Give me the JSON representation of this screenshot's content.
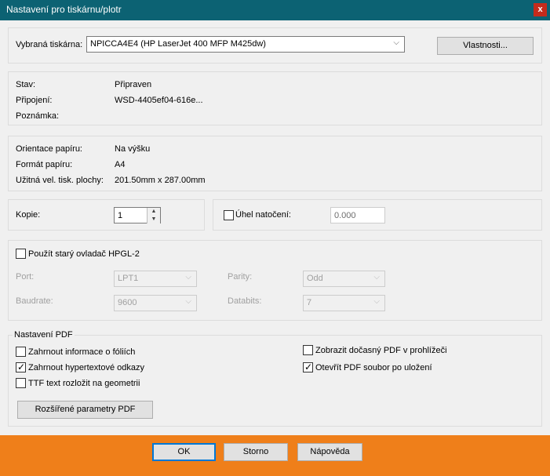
{
  "window": {
    "title": "Nastavení pro tiskárnu/plotr",
    "close_glyph": "x"
  },
  "printer": {
    "label": "Vybraná tiskárna:",
    "selected": "NPICCA4E4 (HP LaserJet 400 MFP M425dw)",
    "properties_button": "Vlastnosti..."
  },
  "status": {
    "state_label": "Stav:",
    "state_value": "Připraven",
    "connection_label": "Připojení:",
    "connection_value": "WSD-4405ef04-616e...",
    "note_label": "Poznámka:"
  },
  "paper": {
    "orientation_label": "Orientace papíru:",
    "orientation_value": "Na výšku",
    "format_label": "Formát papíru:",
    "format_value": "A4",
    "printable_label": "Užitná vel. tisk. plochy:",
    "printable_value": "201.50mm x 287.00mm"
  },
  "copies": {
    "label": "Kopie:",
    "value": "1"
  },
  "rotation": {
    "label": "Úhel natočení:",
    "checked": false,
    "value": "0.000"
  },
  "hpgl": {
    "label": "Použít starý ovladač HPGL-2",
    "checked": false,
    "port_label": "Port:",
    "port_value": "LPT1",
    "parity_label": "Parity:",
    "parity_value": "Odd",
    "baudrate_label": "Baudrate:",
    "baudrate_value": "9600",
    "databits_label": "Databits:",
    "databits_value": "7"
  },
  "pdf": {
    "group_title": "Nastavení PDF",
    "include_foil_info": {
      "label": "Zahrnout informace o fóliích",
      "checked": false
    },
    "include_hyperlinks": {
      "label": "Zahrnout hypertextové odkazy",
      "checked": true
    },
    "ttf_to_geometry": {
      "label": "TTF text rozložit na geometrii",
      "checked": false
    },
    "show_temp_pdf": {
      "label": "Zobrazit dočasný PDF v prohlížeči",
      "checked": false
    },
    "open_after_save": {
      "label": "Otevřít PDF soubor po uložení",
      "checked": true
    },
    "advanced_button": "Rozšířené parametry PDF"
  },
  "buttons": {
    "ok": "OK",
    "cancel": "Storno",
    "help": "Nápověda"
  },
  "glyphs": {
    "combo_arrow": "⌵",
    "check": "✓",
    "spin_up": "▲",
    "spin_down": "▼"
  },
  "colors": {
    "titlebar": "#0c6273",
    "close": "#c42b1c",
    "footer": "#ef7f1a",
    "focus": "#0078d7"
  }
}
